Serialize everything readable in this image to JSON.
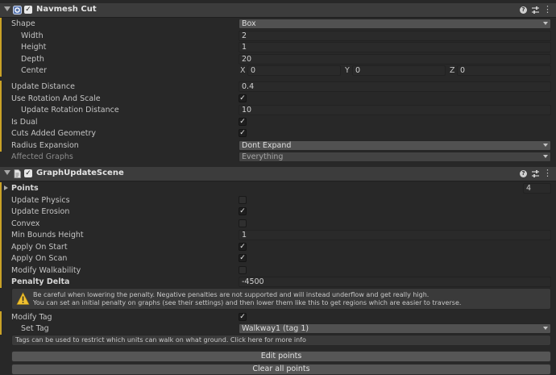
{
  "navmesh_cut": {
    "title": "Navmesh Cut",
    "icons": [
      "navmesh-cut-component-icon",
      "help-icon",
      "sliders-icon",
      "more-icon"
    ],
    "shape": {
      "label": "Shape",
      "value": "Box"
    },
    "width": {
      "label": "Width",
      "value": "2"
    },
    "height": {
      "label": "Height",
      "value": "1"
    },
    "depth": {
      "label": "Depth",
      "value": "20"
    },
    "center": {
      "label": "Center",
      "x_label": "X",
      "x": "0",
      "y_label": "Y",
      "y": "0",
      "z_label": "Z",
      "z": "0"
    },
    "update_distance": {
      "label": "Update Distance",
      "value": "0.4"
    },
    "use_rotation_and_scale": {
      "label": "Use Rotation And Scale",
      "checked": true
    },
    "update_rotation_distance": {
      "label": "Update Rotation Distance",
      "value": "10"
    },
    "is_dual": {
      "label": "Is Dual",
      "checked": true
    },
    "cuts_added_geometry": {
      "label": "Cuts Added Geometry",
      "checked": true
    },
    "radius_expansion": {
      "label": "Radius Expansion",
      "value": "Dont Expand"
    },
    "affected_graphs": {
      "label": "Affected Graphs",
      "value": "Everything"
    }
  },
  "graph_update_scene": {
    "title": "GraphUpdateScene",
    "points": {
      "label": "Points",
      "count": "4"
    },
    "update_physics": {
      "label": "Update Physics",
      "checked": false
    },
    "update_erosion": {
      "label": "Update Erosion",
      "checked": true
    },
    "convex": {
      "label": "Convex",
      "checked": false
    },
    "min_bounds_height": {
      "label": "Min Bounds Height",
      "value": "1"
    },
    "apply_on_start": {
      "label": "Apply On Start",
      "checked": true
    },
    "apply_on_scan": {
      "label": "Apply On Scan",
      "checked": true
    },
    "modify_walkability": {
      "label": "Modify Walkability",
      "checked": false
    },
    "penalty_delta": {
      "label": "Penalty Delta",
      "value": "-4500"
    },
    "warning_line1": "Be careful when lowering the penalty. Negative penalties are not supported and will instead underflow and get really high.",
    "warning_line2": "You can set an initial penalty on graphs (see their settings) and then lower them like this to get regions which are easier to traverse.",
    "modify_tag": {
      "label": "Modify Tag",
      "checked": true
    },
    "set_tag": {
      "label": "Set Tag",
      "value": "Walkway1 (tag 1)"
    },
    "tags_info": "Tags can be used to restrict which units can walk on what ground. Click here for more info",
    "edit_points_label": "Edit points",
    "clear_points_label": "Clear all points"
  },
  "colors": {
    "modified_bar": "#c9a227",
    "background": "#282828",
    "header": "#3c3c3c"
  },
  "check_glyph": "✓"
}
